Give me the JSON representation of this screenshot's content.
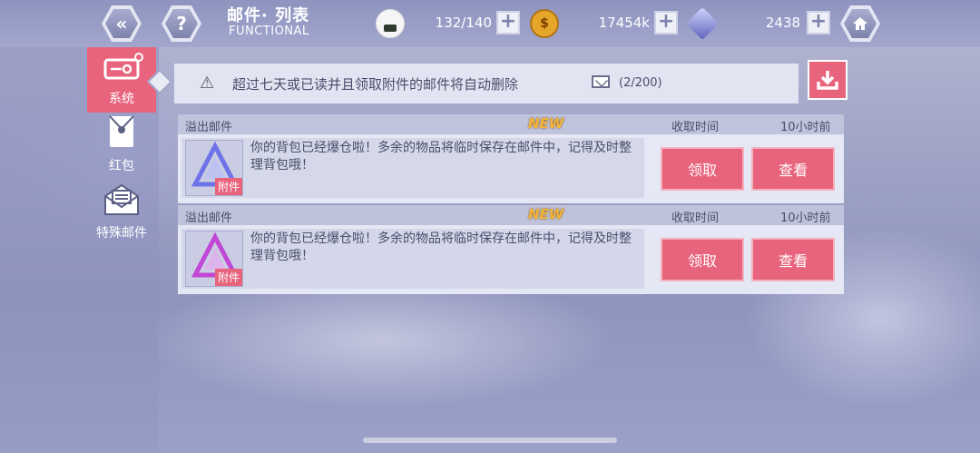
{
  "header": {
    "title": "邮件· 列表",
    "subtitle": "FUNCTIONAL",
    "back_icon": "back-chevron-icon",
    "help_label": "?",
    "home_icon": "home-icon",
    "resources": [
      {
        "icon": "rice-ball-icon",
        "value": "132/140"
      },
      {
        "icon": "coin-icon",
        "value": "17454k"
      },
      {
        "icon": "crystal-icon",
        "value": "2438"
      }
    ]
  },
  "sidebar": {
    "items": [
      {
        "label": "系统",
        "icon": "mailbox-icon",
        "active": true
      },
      {
        "label": "红包",
        "icon": "red-envelope-icon"
      },
      {
        "label": "特殊邮件",
        "icon": "special-mail-icon"
      }
    ]
  },
  "notice": {
    "text": "超过七天或已读并且领取附件的邮件将自动删除",
    "count": "(2/200)"
  },
  "mails": [
    {
      "category": "溢出邮件",
      "badge": "NEW",
      "time_label": "收取时间",
      "time_value": "10小时前",
      "item_tag": "附件",
      "text": "你的背包已经爆仓啦！多余的物品将临时保存在邮件中，记得及时整理背包哦！",
      "claim": "领取",
      "view": "查看",
      "item_color": "#6f73e8"
    },
    {
      "category": "溢出邮件",
      "badge": "NEW",
      "time_label": "收取时间",
      "time_value": "10小时前",
      "item_tag": "附件",
      "text": "你的背包已经爆仓啦！多余的物品将临时保存在邮件中，记得及时整理背包哦！",
      "claim": "领取",
      "view": "查看",
      "item_color": "#c247d6"
    }
  ],
  "colors": {
    "accent": "#e8637c",
    "new_badge": "#f4b53b"
  }
}
